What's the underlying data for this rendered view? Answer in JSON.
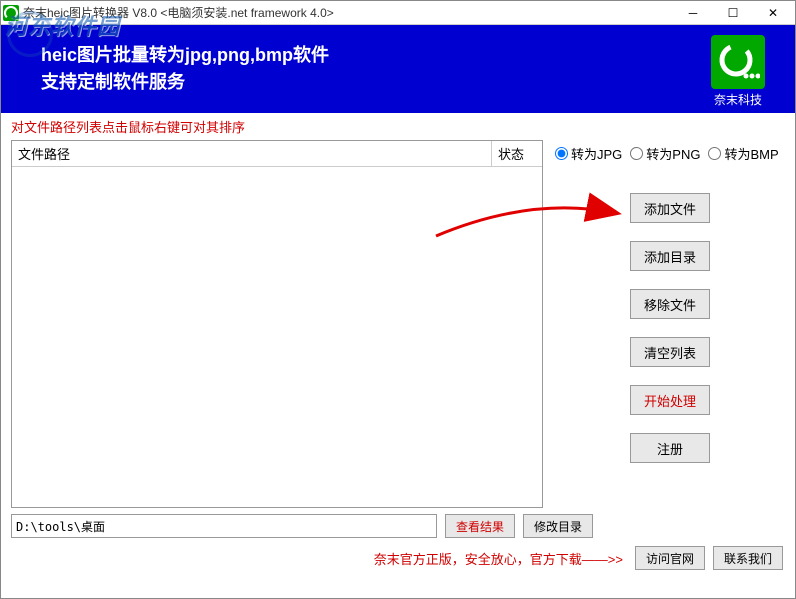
{
  "titlebar": {
    "title": "奈末heic图片转换器 V8.0 <电脑须安装.net framework 4.0>"
  },
  "watermark": "河东软件园",
  "banner": {
    "line1": "heic图片批量转为jpg,png,bmp软件",
    "line2": "支持定制软件服务",
    "brand": "奈末科技"
  },
  "hint": "对文件路径列表点击鼠标右键可对其排序",
  "table": {
    "col_path": "文件路径",
    "col_status": "状态"
  },
  "radios": {
    "jpg": "转为JPG",
    "png": "转为PNG",
    "bmp": "转为BMP"
  },
  "buttons": {
    "add_file": "添加文件",
    "add_dir": "添加目录",
    "remove_file": "移除文件",
    "clear_list": "清空列表",
    "start": "开始处理",
    "register": "注册",
    "view_result": "查看结果",
    "change_dir": "修改目录",
    "visit_site": "访问官网",
    "contact": "联系我们"
  },
  "output_path": "D:\\tools\\桌面",
  "footer_text": "奈末官方正版，安全放心，官方下载——>>"
}
